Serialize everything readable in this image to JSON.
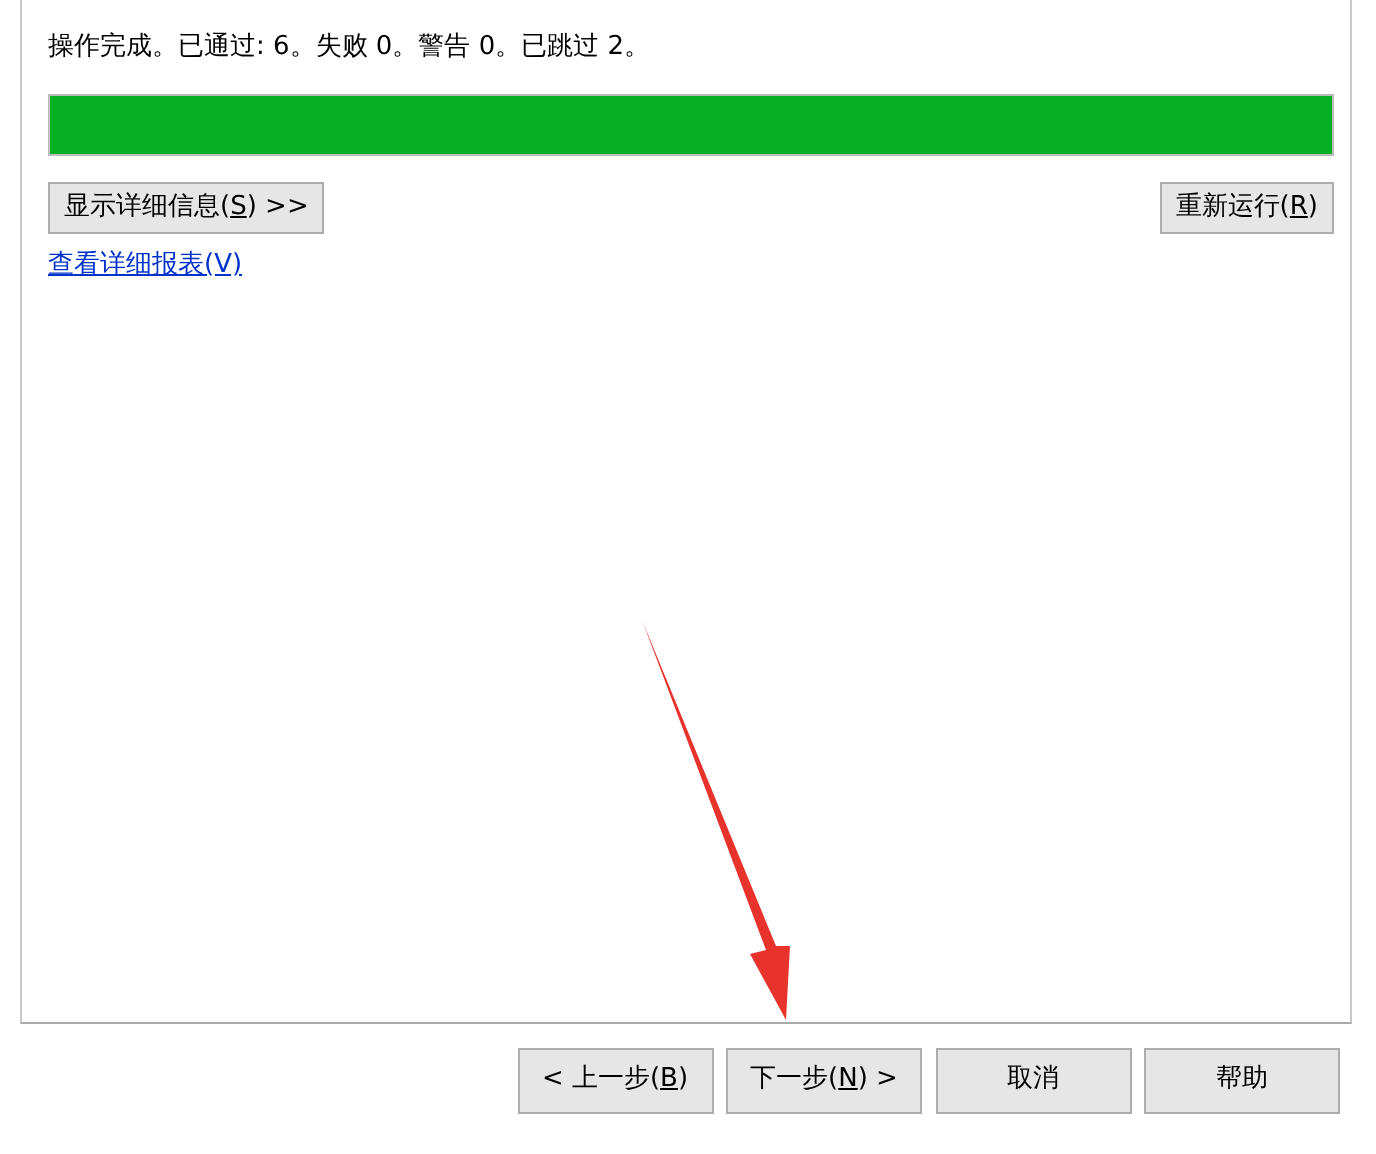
{
  "status": "操作完成。已通过: 6。失败 0。警告 0。已跳过 2。",
  "progress": {
    "level": 1
  },
  "details_button": {
    "before": "显示详细信息(",
    "key": "S",
    "after": ") >>"
  },
  "rerun_button": {
    "before": "重新运行(",
    "key": "R",
    "after": ")"
  },
  "report_link": "查看详细报表(V)",
  "nav_buttons": [
    {
      "before": "< 上一步(",
      "key": "B",
      "after": ")"
    },
    {
      "before": "下一步(",
      "key": "N",
      "after": ") >"
    },
    {
      "before": "取消"
    },
    {
      "before": "帮助"
    }
  ]
}
